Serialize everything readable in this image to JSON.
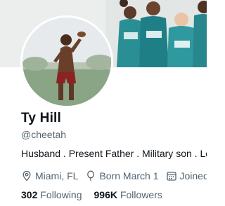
{
  "profile": {
    "name": "Ty Hill",
    "handle": "@cheetah",
    "bio": "Husband . Present Father . Military son . Lea",
    "location": "Miami, FL",
    "birthday": "Born March 1",
    "joined": "Joined",
    "following_count": "302",
    "following_label": "Following",
    "followers_count": "996K",
    "followers_label": "Followers"
  },
  "icons": {
    "location": "location-pin-icon",
    "birthday": "balloon-icon",
    "joined": "calendar-icon"
  },
  "colors": {
    "text_primary": "#0f1419",
    "text_secondary": "#536471",
    "jersey_teal": "#2a8f94"
  }
}
